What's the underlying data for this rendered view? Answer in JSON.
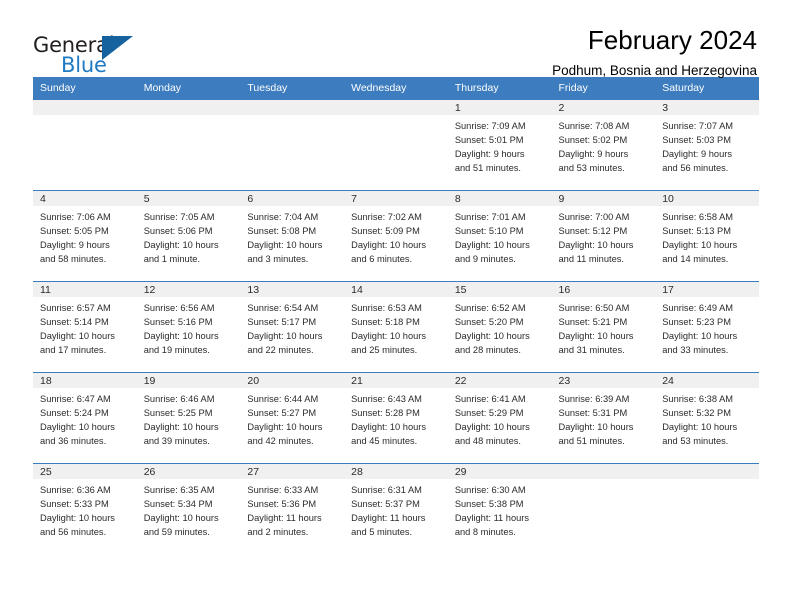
{
  "brand": {
    "name_top": "General",
    "name_bottom": "Blue",
    "triangle_icon": "brand-triangle-icon",
    "color_dark": "#231f20",
    "color_blue": "#1f7ac4",
    "color_triangle": "#15629f"
  },
  "header": {
    "title": "February 2024",
    "subtitle": "Podhum, Bosnia and Herzegovina"
  },
  "theme": {
    "header_bg": "#3d7dbf",
    "header_text": "#ffffff",
    "daynum_bg": "#f0f0f0",
    "cell_text": "#2b2b2b"
  },
  "weekdays": [
    "Sunday",
    "Monday",
    "Tuesday",
    "Wednesday",
    "Thursday",
    "Friday",
    "Saturday"
  ],
  "weeks": [
    [
      {
        "day": "",
        "lines": []
      },
      {
        "day": "",
        "lines": []
      },
      {
        "day": "",
        "lines": []
      },
      {
        "day": "",
        "lines": []
      },
      {
        "day": "1",
        "lines": [
          "Sunrise: 7:09 AM",
          "Sunset: 5:01 PM",
          "Daylight: 9 hours",
          "and 51 minutes."
        ]
      },
      {
        "day": "2",
        "lines": [
          "Sunrise: 7:08 AM",
          "Sunset: 5:02 PM",
          "Daylight: 9 hours",
          "and 53 minutes."
        ]
      },
      {
        "day": "3",
        "lines": [
          "Sunrise: 7:07 AM",
          "Sunset: 5:03 PM",
          "Daylight: 9 hours",
          "and 56 minutes."
        ]
      }
    ],
    [
      {
        "day": "4",
        "lines": [
          "Sunrise: 7:06 AM",
          "Sunset: 5:05 PM",
          "Daylight: 9 hours",
          "and 58 minutes."
        ]
      },
      {
        "day": "5",
        "lines": [
          "Sunrise: 7:05 AM",
          "Sunset: 5:06 PM",
          "Daylight: 10 hours",
          "and 1 minute."
        ]
      },
      {
        "day": "6",
        "lines": [
          "Sunrise: 7:04 AM",
          "Sunset: 5:08 PM",
          "Daylight: 10 hours",
          "and 3 minutes."
        ]
      },
      {
        "day": "7",
        "lines": [
          "Sunrise: 7:02 AM",
          "Sunset: 5:09 PM",
          "Daylight: 10 hours",
          "and 6 minutes."
        ]
      },
      {
        "day": "8",
        "lines": [
          "Sunrise: 7:01 AM",
          "Sunset: 5:10 PM",
          "Daylight: 10 hours",
          "and 9 minutes."
        ]
      },
      {
        "day": "9",
        "lines": [
          "Sunrise: 7:00 AM",
          "Sunset: 5:12 PM",
          "Daylight: 10 hours",
          "and 11 minutes."
        ]
      },
      {
        "day": "10",
        "lines": [
          "Sunrise: 6:58 AM",
          "Sunset: 5:13 PM",
          "Daylight: 10 hours",
          "and 14 minutes."
        ]
      }
    ],
    [
      {
        "day": "11",
        "lines": [
          "Sunrise: 6:57 AM",
          "Sunset: 5:14 PM",
          "Daylight: 10 hours",
          "and 17 minutes."
        ]
      },
      {
        "day": "12",
        "lines": [
          "Sunrise: 6:56 AM",
          "Sunset: 5:16 PM",
          "Daylight: 10 hours",
          "and 19 minutes."
        ]
      },
      {
        "day": "13",
        "lines": [
          "Sunrise: 6:54 AM",
          "Sunset: 5:17 PM",
          "Daylight: 10 hours",
          "and 22 minutes."
        ]
      },
      {
        "day": "14",
        "lines": [
          "Sunrise: 6:53 AM",
          "Sunset: 5:18 PM",
          "Daylight: 10 hours",
          "and 25 minutes."
        ]
      },
      {
        "day": "15",
        "lines": [
          "Sunrise: 6:52 AM",
          "Sunset: 5:20 PM",
          "Daylight: 10 hours",
          "and 28 minutes."
        ]
      },
      {
        "day": "16",
        "lines": [
          "Sunrise: 6:50 AM",
          "Sunset: 5:21 PM",
          "Daylight: 10 hours",
          "and 31 minutes."
        ]
      },
      {
        "day": "17",
        "lines": [
          "Sunrise: 6:49 AM",
          "Sunset: 5:23 PM",
          "Daylight: 10 hours",
          "and 33 minutes."
        ]
      }
    ],
    [
      {
        "day": "18",
        "lines": [
          "Sunrise: 6:47 AM",
          "Sunset: 5:24 PM",
          "Daylight: 10 hours",
          "and 36 minutes."
        ]
      },
      {
        "day": "19",
        "lines": [
          "Sunrise: 6:46 AM",
          "Sunset: 5:25 PM",
          "Daylight: 10 hours",
          "and 39 minutes."
        ]
      },
      {
        "day": "20",
        "lines": [
          "Sunrise: 6:44 AM",
          "Sunset: 5:27 PM",
          "Daylight: 10 hours",
          "and 42 minutes."
        ]
      },
      {
        "day": "21",
        "lines": [
          "Sunrise: 6:43 AM",
          "Sunset: 5:28 PM",
          "Daylight: 10 hours",
          "and 45 minutes."
        ]
      },
      {
        "day": "22",
        "lines": [
          "Sunrise: 6:41 AM",
          "Sunset: 5:29 PM",
          "Daylight: 10 hours",
          "and 48 minutes."
        ]
      },
      {
        "day": "23",
        "lines": [
          "Sunrise: 6:39 AM",
          "Sunset: 5:31 PM",
          "Daylight: 10 hours",
          "and 51 minutes."
        ]
      },
      {
        "day": "24",
        "lines": [
          "Sunrise: 6:38 AM",
          "Sunset: 5:32 PM",
          "Daylight: 10 hours",
          "and 53 minutes."
        ]
      }
    ],
    [
      {
        "day": "25",
        "lines": [
          "Sunrise: 6:36 AM",
          "Sunset: 5:33 PM",
          "Daylight: 10 hours",
          "and 56 minutes."
        ]
      },
      {
        "day": "26",
        "lines": [
          "Sunrise: 6:35 AM",
          "Sunset: 5:34 PM",
          "Daylight: 10 hours",
          "and 59 minutes."
        ]
      },
      {
        "day": "27",
        "lines": [
          "Sunrise: 6:33 AM",
          "Sunset: 5:36 PM",
          "Daylight: 11 hours",
          "and 2 minutes."
        ]
      },
      {
        "day": "28",
        "lines": [
          "Sunrise: 6:31 AM",
          "Sunset: 5:37 PM",
          "Daylight: 11 hours",
          "and 5 minutes."
        ]
      },
      {
        "day": "29",
        "lines": [
          "Sunrise: 6:30 AM",
          "Sunset: 5:38 PM",
          "Daylight: 11 hours",
          "and 8 minutes."
        ]
      },
      {
        "day": "",
        "lines": []
      },
      {
        "day": "",
        "lines": []
      }
    ]
  ]
}
